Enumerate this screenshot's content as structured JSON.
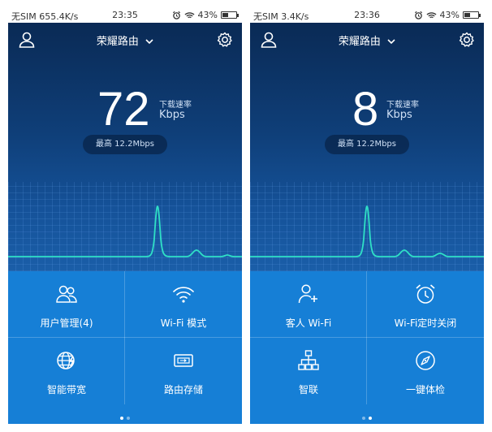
{
  "screens": [
    {
      "status": {
        "carrier_speed": "无SIM 655.4K/s",
        "time": "23:35",
        "battery": "43%"
      },
      "router_name": "荣耀路由",
      "speed": {
        "value": "72",
        "caption": "下载速率",
        "unit": "Kbps",
        "max": "最高 12.2Mbps"
      },
      "tiles": [
        {
          "label": "用户管理(4)",
          "icon": "users-icon"
        },
        {
          "label": "Wi-Fi 模式",
          "icon": "wifi-icon"
        },
        {
          "label": "智能带宽",
          "icon": "globe-bandwidth-icon"
        },
        {
          "label": "路由存储",
          "icon": "storage-icon"
        }
      ],
      "page_indicator": {
        "current": 1,
        "total": 2
      }
    },
    {
      "status": {
        "carrier_speed": "无SIM 3.4K/s",
        "time": "23:36",
        "battery": "43%"
      },
      "router_name": "荣耀路由",
      "speed": {
        "value": "8",
        "caption": "下载速率",
        "unit": "Kbps",
        "max": "最高 12.2Mbps"
      },
      "tiles": [
        {
          "label": "客人 Wi-Fi",
          "icon": "add-guest-icon"
        },
        {
          "label": "Wi-Fi定时关闭",
          "icon": "alarm-clock-icon"
        },
        {
          "label": "智联",
          "icon": "network-topology-icon"
        },
        {
          "label": "一键体检",
          "icon": "compass-check-icon"
        }
      ],
      "page_indicator": {
        "current": 2,
        "total": 2
      }
    }
  ],
  "colors": {
    "hero_top": "#0a2a55",
    "hero_bottom": "#1a5ea8",
    "tile_bg": "#167fd6",
    "wave": "#2fe0c6"
  }
}
